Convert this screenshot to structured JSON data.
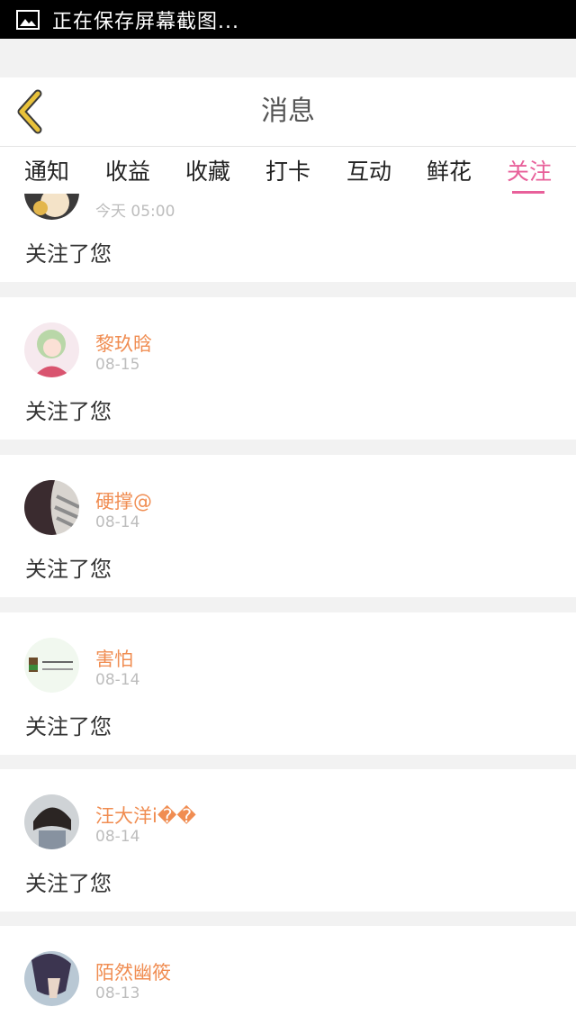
{
  "status_bar": {
    "text": "正在保存屏幕截图..."
  },
  "header": {
    "title": "消息"
  },
  "tabs": [
    {
      "label": "通知"
    },
    {
      "label": "收益"
    },
    {
      "label": "收藏"
    },
    {
      "label": "打卡"
    },
    {
      "label": "互动"
    },
    {
      "label": "鲜花"
    },
    {
      "label": "关注",
      "active": true
    }
  ],
  "messages": [
    {
      "name": "",
      "time": "今天 05:00",
      "text": "关注了您"
    },
    {
      "name": "黎玖晗",
      "time": "08-15",
      "text": "关注了您"
    },
    {
      "name": "硬撑@",
      "time": "08-14",
      "text": "关注了您"
    },
    {
      "name": "害怕",
      "time": "08-14",
      "text": "关注了您"
    },
    {
      "name": "汪大洋i��",
      "time": "08-14",
      "text": "关注了您"
    },
    {
      "name": "陌然幽筱",
      "time": "08-13",
      "text": ""
    }
  ],
  "colors": {
    "accent": "#e8609a",
    "username": "#f08d52",
    "back_arrow": "#e9c23a"
  }
}
